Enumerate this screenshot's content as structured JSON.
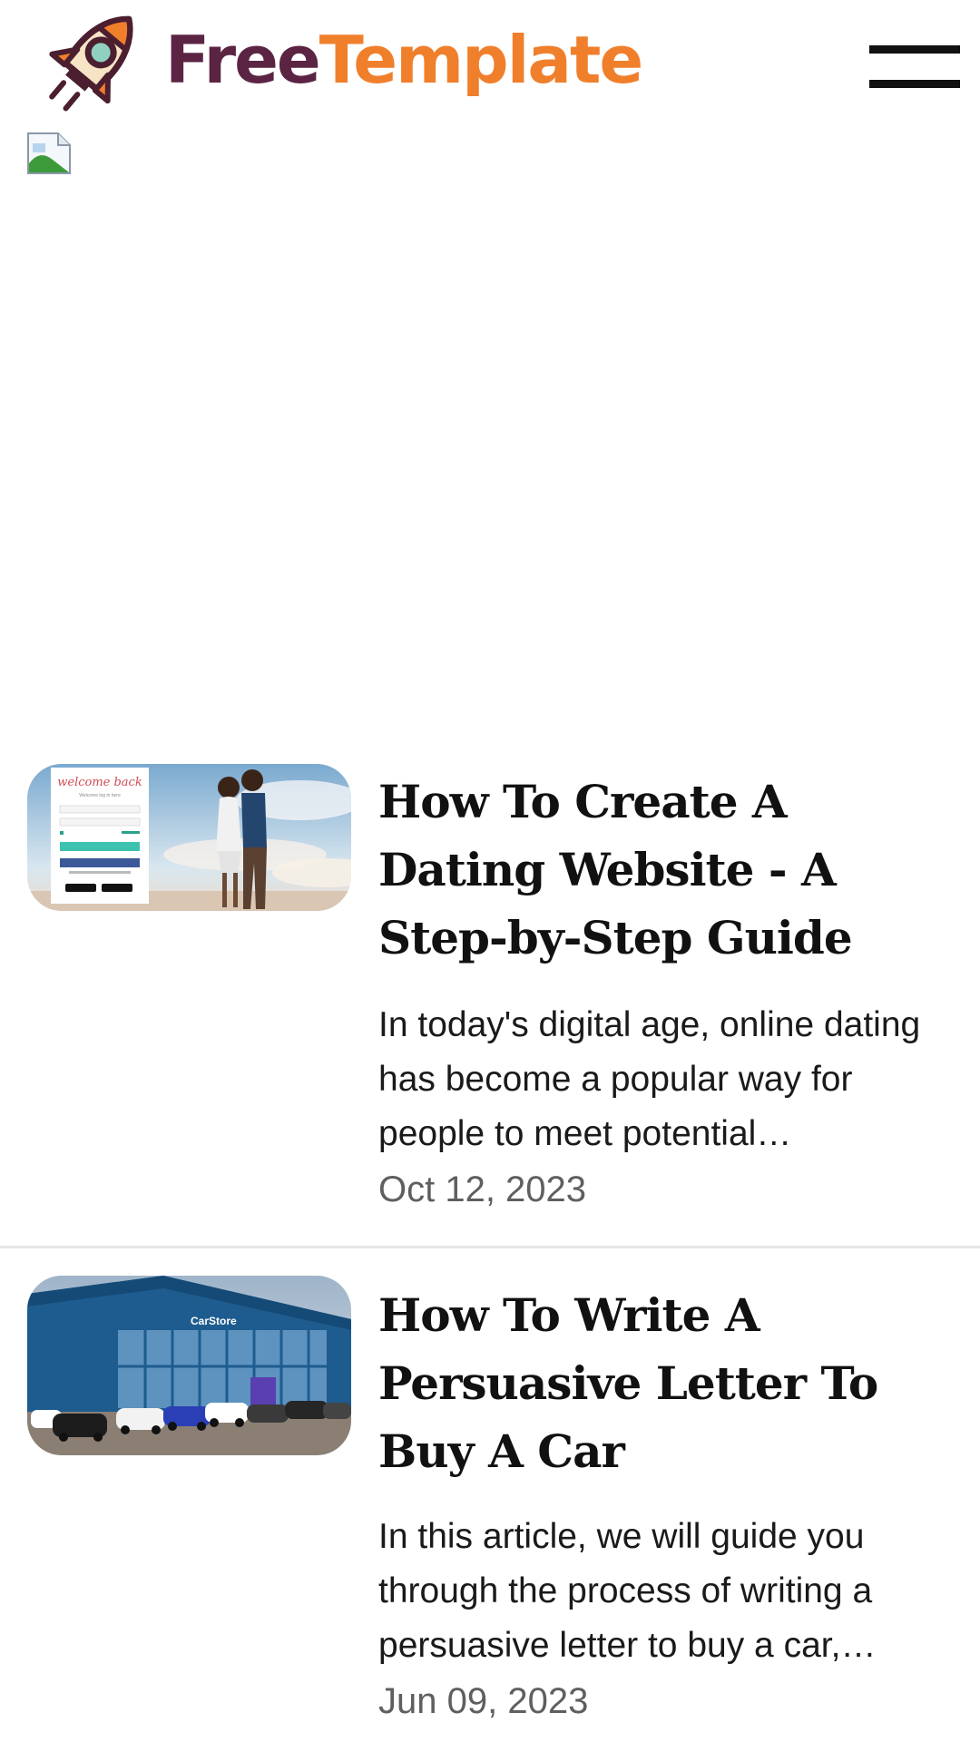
{
  "header": {
    "brand_part1": "Free",
    "brand_part2": "Template",
    "brand_color_part1": "#5b2443",
    "brand_color_part2": "#f07f2c",
    "logo_icon": "rocket-icon",
    "menu_icon": "hamburger-menu-icon"
  },
  "banner": {
    "icon": "broken-image-icon"
  },
  "articles": [
    {
      "title": "How To Create A Dating Website - A Step-by-Step Guide",
      "excerpt": "In today's digital age, online dating has become a popular way for people to meet potential…",
      "date": "Oct 12, 2023",
      "thumbnail": {
        "welcome_text": "welcome back",
        "subtitle_text": "Welcome log in here"
      }
    },
    {
      "title": "How To Write A Persuasive Letter To Buy A Car",
      "excerpt": "In this article, we will guide you through the process of writing a persuasive letter to buy a car,…",
      "date": "Jun 09, 2023",
      "thumbnail": {
        "sign_text": "CarStore"
      }
    }
  ]
}
